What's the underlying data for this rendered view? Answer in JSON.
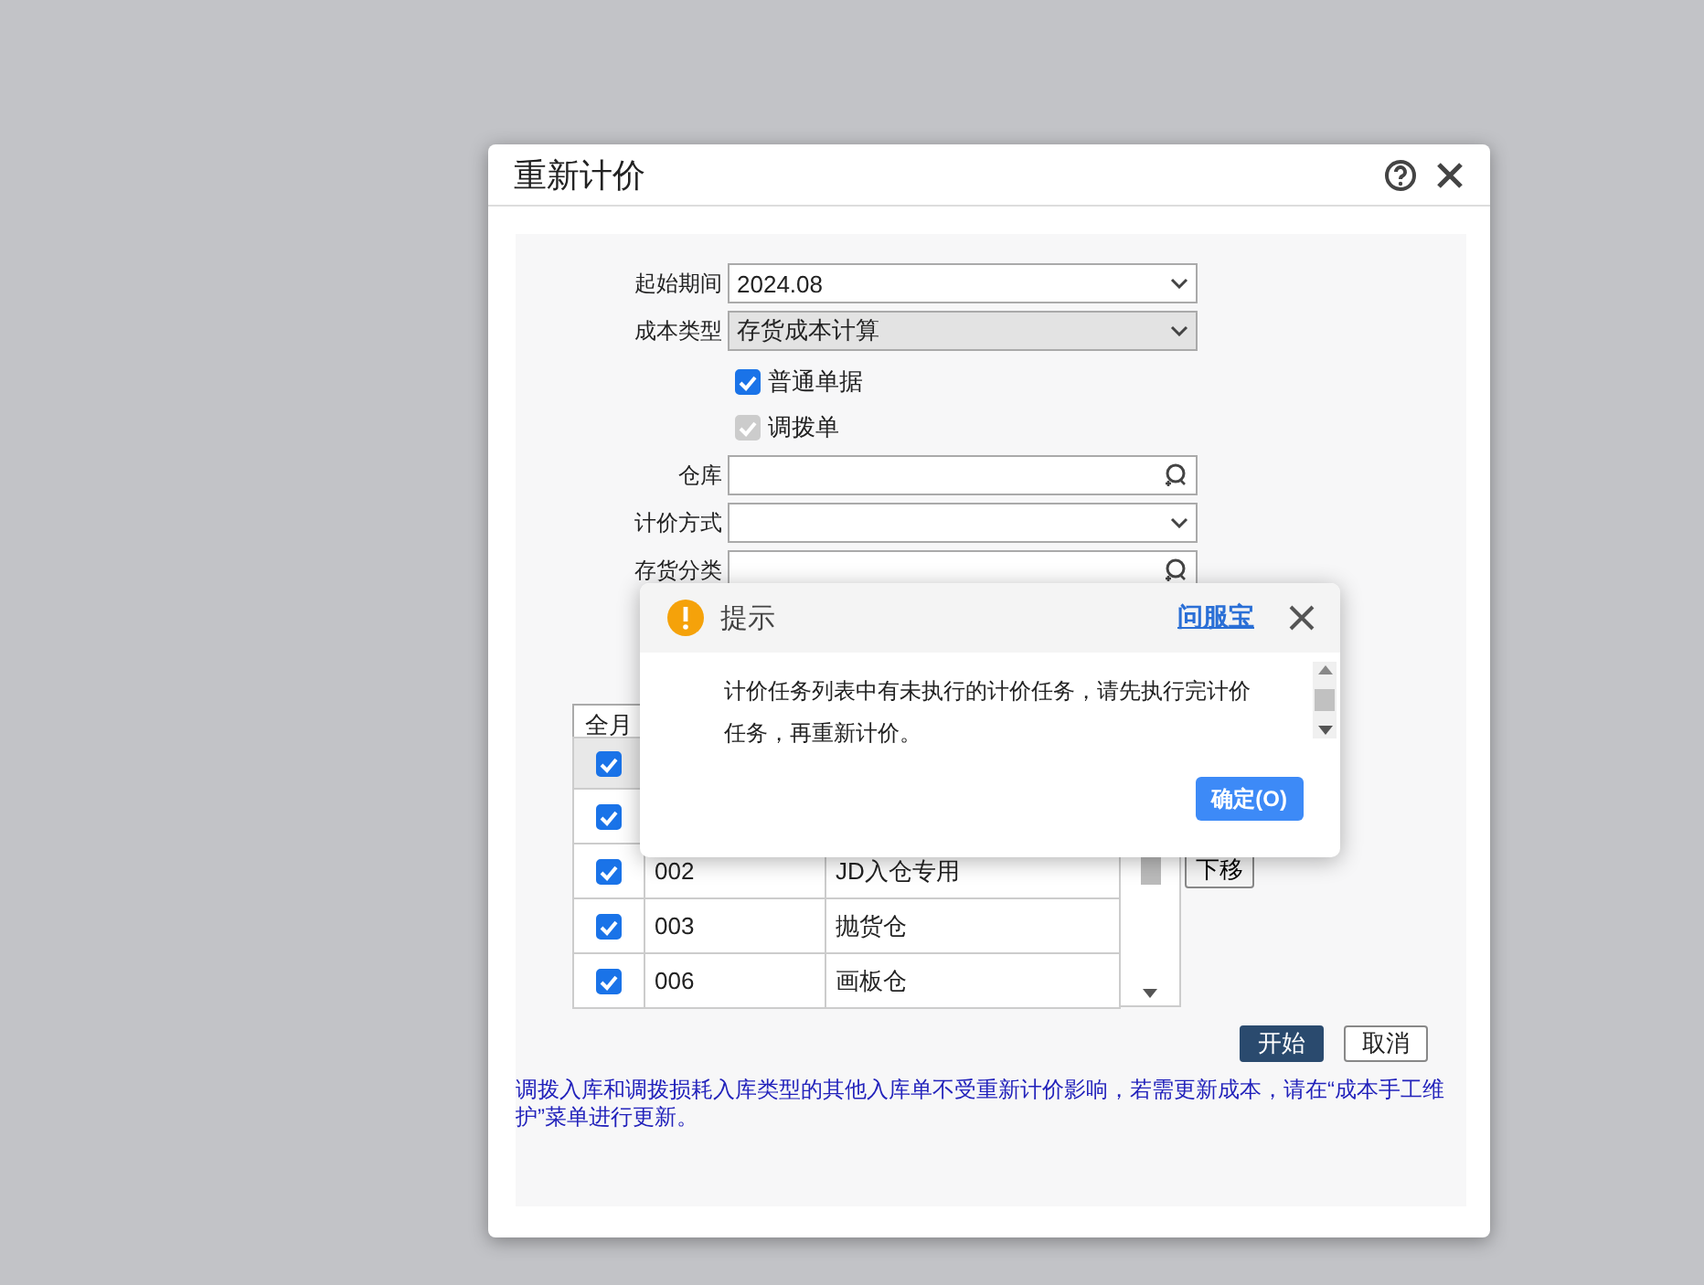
{
  "dialog": {
    "title": "重新计价",
    "form": [
      {
        "kind": "select",
        "label": "起始期间",
        "value": "2024.08",
        "readonly": false
      },
      {
        "kind": "select",
        "label": "成本类型",
        "value": "存货成本计算",
        "readonly": true
      },
      {
        "kind": "checkbox",
        "label": "普通单据",
        "checked": true,
        "disabled": false
      },
      {
        "kind": "checkbox",
        "label": "调拨单",
        "checked": true,
        "disabled": true
      },
      {
        "kind": "lookup",
        "label": "仓库",
        "readonly": false
      },
      {
        "kind": "select",
        "label": "计价方式",
        "readonly": false
      },
      {
        "kind": "lookup",
        "label": "存货分类",
        "readonly": false
      }
    ],
    "method": {
      "value": "全月"
    },
    "table": {
      "header_checked": true,
      "rows": [
        {
          "checked": true
        },
        {
          "checked": true,
          "code": "002",
          "name": "JD入仓专用"
        },
        {
          "checked": true,
          "code": "003",
          "name": "抛货仓"
        },
        {
          "checked": true,
          "code": "006",
          "name": "画板仓"
        }
      ]
    },
    "move_down": "下移",
    "buttons": [
      {
        "kind": "primary",
        "label": "开始"
      },
      {
        "kind": "default",
        "label": "取消"
      }
    ],
    "note": "调拨入库和调拨损耗入库类型的其他入库单不受重新计价影响，若需更新成本，请在“成本手工维护”菜单进行更新。"
  },
  "popup": {
    "title": "提示",
    "link": "问服宝",
    "message": "计价任务列表中有未执行的计价任务，请先执行完计价任务，再重新计价。",
    "confirm": "确定(O)"
  }
}
